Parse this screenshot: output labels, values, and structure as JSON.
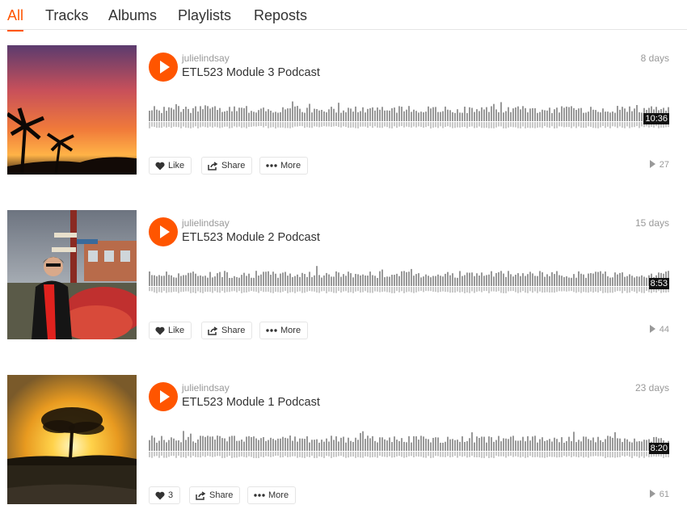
{
  "tabs": [
    {
      "label": "All",
      "active": true
    },
    {
      "label": "Tracks",
      "active": false
    },
    {
      "label": "Albums",
      "active": false
    },
    {
      "label": "Playlists",
      "active": false
    },
    {
      "label": "Reposts",
      "active": false
    }
  ],
  "colors": {
    "accent": "#ff5500",
    "waveform": "#999999",
    "text": "#333333",
    "muted": "#999999"
  },
  "tracks": [
    {
      "username": "julielindsay",
      "title": "ETL523 Module 3 Podcast",
      "date": "8 days",
      "duration": "10:36",
      "like_label": "Like",
      "share_label": "Share",
      "more_label": "More",
      "plays": "27",
      "artwork_icon": "sunset-palm-image"
    },
    {
      "username": "julielindsay",
      "title": "ETL523 Module 2 Podcast",
      "date": "15 days",
      "duration": "8:53",
      "like_label": "Like",
      "share_label": "Share",
      "more_label": "More",
      "plays": "44",
      "artwork_icon": "person-signpost-tulips-image"
    },
    {
      "username": "julielindsay",
      "title": "ETL523 Module 1 Podcast",
      "date": "23 days",
      "duration": "8:20",
      "like_label": "3",
      "share_label": "Share",
      "more_label": "More",
      "plays": "61",
      "artwork_icon": "tree-sunset-image"
    }
  ]
}
